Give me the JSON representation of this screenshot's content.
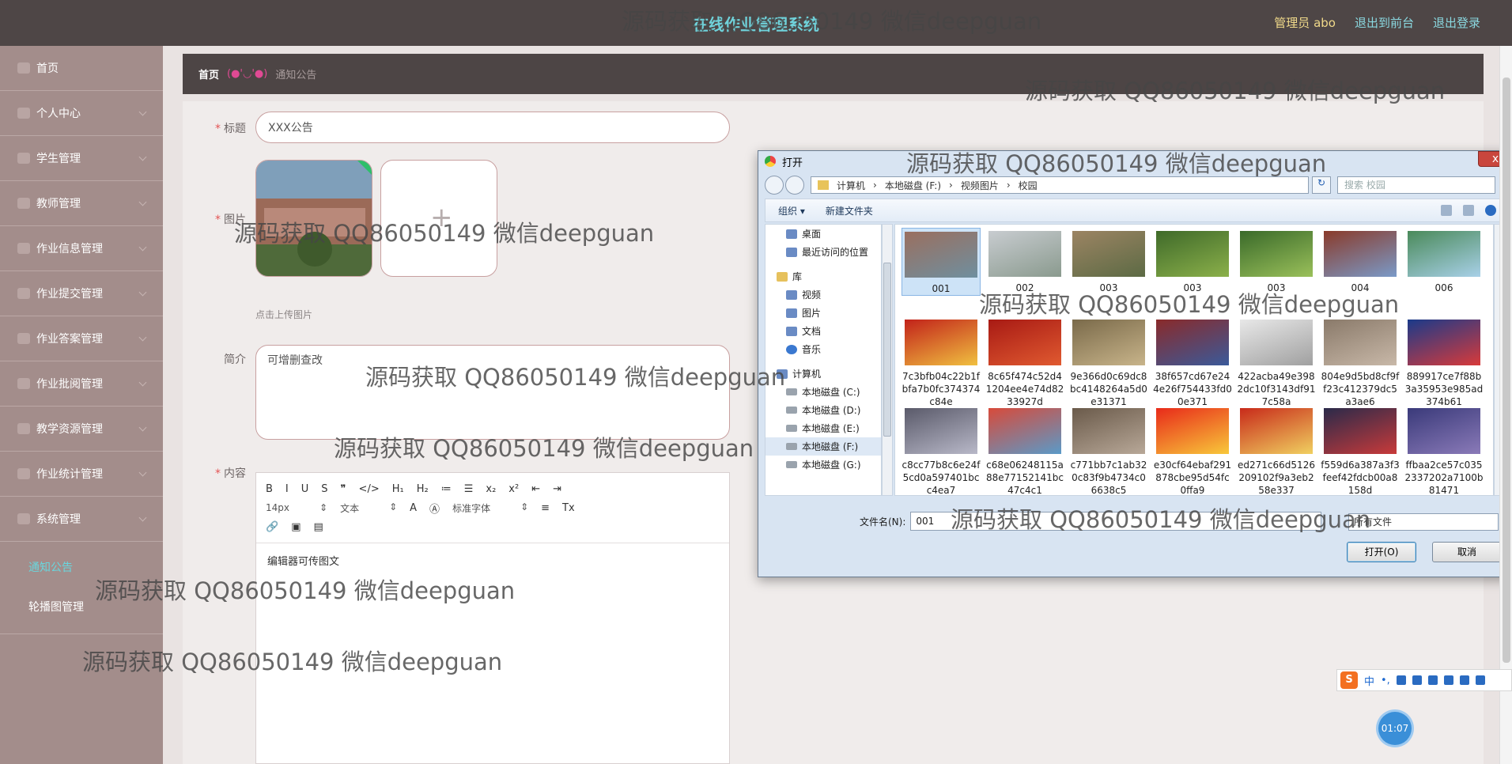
{
  "header": {
    "title": "在线作业管理系统",
    "admin": "管理员 abo",
    "to_front": "退出到前台",
    "logout": "退出登录"
  },
  "sidebar": {
    "items": [
      {
        "label": "首页"
      },
      {
        "label": "个人中心"
      },
      {
        "label": "学生管理"
      },
      {
        "label": "教师管理"
      },
      {
        "label": "作业信息管理"
      },
      {
        "label": "作业提交管理"
      },
      {
        "label": "作业答案管理"
      },
      {
        "label": "作业批阅管理"
      },
      {
        "label": "教学资源管理"
      },
      {
        "label": "作业统计管理"
      },
      {
        "label": "系统管理"
      }
    ],
    "sub": [
      {
        "label": "通知公告"
      },
      {
        "label": "轮播图管理"
      }
    ]
  },
  "breadcrumb": {
    "home": "首页",
    "emoticon": "(●'◡'●)",
    "current": "通知公告"
  },
  "form": {
    "title_label": "标题",
    "title_value": "XXX公告",
    "image_label": "图片",
    "upload_hint": "点击上传图片",
    "intro_label": "简介",
    "intro_value": "可增删查改",
    "content_label": "内容",
    "content_value": "编辑器可传图文",
    "toolbar": {
      "row1": [
        "B",
        "I",
        "U",
        "S",
        "❞",
        "</>",
        "H₁",
        "H₂",
        "≔",
        "☰",
        "x₂",
        "x²",
        "⇤",
        "⇥"
      ],
      "font_size": "14px",
      "text_type": "文本",
      "font_family": "标准字体",
      "row2_icons": [
        "A",
        "Ⓐ",
        "≡",
        "Tx"
      ],
      "row3": [
        "🔗",
        "▣",
        "▤"
      ]
    }
  },
  "dialog": {
    "title": "打开",
    "close": "x",
    "path": [
      "计算机",
      "本地磁盘 (F:)",
      "视频图片",
      "校园"
    ],
    "search_placeholder": "搜索 校园",
    "organize": "组织 ▾",
    "new_folder": "新建文件夹",
    "tree": [
      {
        "label": "桌面",
        "type": "folder"
      },
      {
        "label": "最近访问的位置",
        "type": "folder"
      },
      {
        "label": "库",
        "type": "lib",
        "group": true
      },
      {
        "label": "视频",
        "type": "folder"
      },
      {
        "label": "图片",
        "type": "folder"
      },
      {
        "label": "文档",
        "type": "folder"
      },
      {
        "label": "音乐",
        "type": "music"
      },
      {
        "label": "计算机",
        "type": "folder",
        "group": true
      },
      {
        "label": "本地磁盘 (C:)",
        "type": "drive"
      },
      {
        "label": "本地磁盘 (D:)",
        "type": "drive"
      },
      {
        "label": "本地磁盘 (E:)",
        "type": "drive"
      },
      {
        "label": "本地磁盘 (F:)",
        "type": "drive",
        "selected": true
      },
      {
        "label": "本地磁盘 (G:)",
        "type": "drive"
      }
    ],
    "files": [
      {
        "name": "001",
        "colors": [
          "#9a6f5f",
          "#6f8f9f"
        ],
        "selected": true
      },
      {
        "name": "002",
        "colors": [
          "#c8ccd0",
          "#8a9a8e"
        ]
      },
      {
        "name": "003",
        "colors": [
          "#9c8463",
          "#5c6a44"
        ]
      },
      {
        "name": "003",
        "colors": [
          "#3f6a2a",
          "#8bb04a"
        ]
      },
      {
        "name": "003",
        "colors": [
          "#3a6a2a",
          "#9ac05a"
        ]
      },
      {
        "name": "004",
        "colors": [
          "#8a3a2a",
          "#7a9ac8"
        ]
      },
      {
        "name": "006",
        "colors": [
          "#4a8a5a",
          "#a8d0e8"
        ]
      },
      {
        "name": "7c3bfb04c22b1fbfa7b0fc374374c84e",
        "colors": [
          "#c2221a",
          "#f0c040"
        ]
      },
      {
        "name": "8c65f474c52d41204ee4e74d8233927d",
        "colors": [
          "#a81a14",
          "#e05a30"
        ]
      },
      {
        "name": "9e366d0c69dc8bc4148264a5d0e31371",
        "colors": [
          "#7a6a4a",
          "#c8b48a"
        ]
      },
      {
        "name": "38f657cd67e244e26f754433fd00e371",
        "colors": [
          "#8a2a2a",
          "#3a5a9a"
        ]
      },
      {
        "name": "422acba49e3982dc10f3143df917c58a",
        "colors": [
          "#e8e8e8",
          "#a0a0a0"
        ]
      },
      {
        "name": "804e9d5bd8cf9ff23c412379dc5a3ae6",
        "colors": [
          "#8a7a6a",
          "#c8b8a8"
        ]
      },
      {
        "name": "889917ce7f88b3a35953e985ad374b61",
        "colors": [
          "#1a3a8a",
          "#d83a3a"
        ]
      },
      {
        "name": "c8cc77b8c6e24f5cd0a597401bcc4ea7",
        "colors": [
          "#5a5a6a",
          "#b8b8c8"
        ]
      },
      {
        "name": "c68e06248115a88e77152141bc47c4c1",
        "colors": [
          "#d84a3a",
          "#5a9ac8"
        ]
      },
      {
        "name": "c771bb7c1ab320c83f9b4734c06638c5",
        "colors": [
          "#6a5a4a",
          "#b8a898"
        ]
      },
      {
        "name": "e30cf64ebaf291878cbe95d54fc0ffa9",
        "colors": [
          "#e82a1a",
          "#f8c83a"
        ]
      },
      {
        "name": "ed271c66d5126209102f9a3eb258e337",
        "colors": [
          "#c82a1a",
          "#f0d060"
        ]
      },
      {
        "name": "f559d6a387a3f3feef42fdcb00a8158d",
        "colors": [
          "#2a2a4a",
          "#c83a3a"
        ]
      },
      {
        "name": "ffbaa2ce57c0352337202a7100b81471",
        "colors": [
          "#3a3a7a",
          "#8a7ab8"
        ]
      }
    ],
    "filename_label": "文件名(N):",
    "filename_value": "001",
    "filetype": "所有文件",
    "open": "打开(O)",
    "cancel": "取消"
  },
  "ime": {
    "s": "S",
    "mode": "中",
    "punct": "•,"
  },
  "clock": "01:07",
  "watermark": "源码获取 QQ86050149 微信deepguan"
}
